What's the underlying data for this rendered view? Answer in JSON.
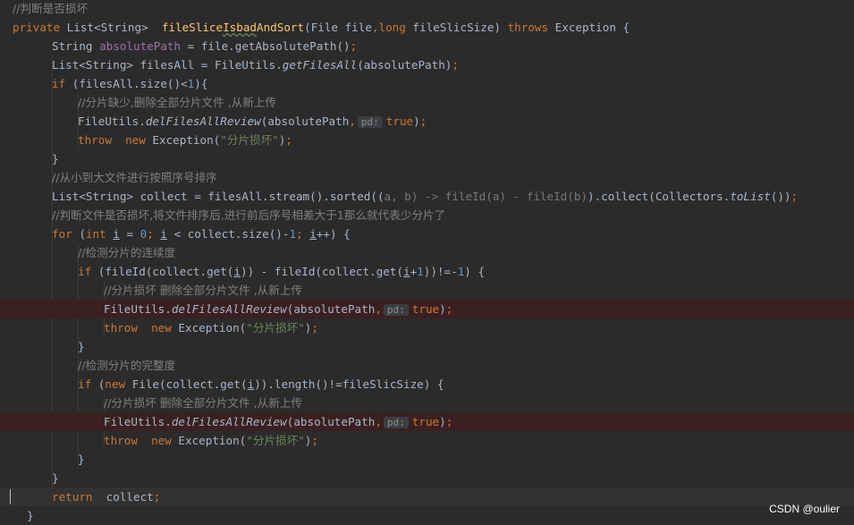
{
  "editor": {
    "lines": [
      {
        "tokens": [
          {
            "t": "//判断是否损坏",
            "c": "cm"
          }
        ]
      },
      {
        "tokens": [
          {
            "t": "private ",
            "c": "kw"
          },
          {
            "t": "List<String>  ",
            "c": "pl"
          },
          {
            "t": "fileSlice",
            "c": "fn"
          },
          {
            "t": "Isbad",
            "c": "fn wavy"
          },
          {
            "t": "AndSort",
            "c": "fn"
          },
          {
            "t": "(File file",
            "c": "pl"
          },
          {
            "t": ",",
            "c": "kw"
          },
          {
            "t": "long ",
            "c": "kw"
          },
          {
            "t": "fileSlicSize) ",
            "c": "pl"
          },
          {
            "t": "throws ",
            "c": "kw"
          },
          {
            "t": "Exception {",
            "c": "pl"
          }
        ]
      },
      {
        "tokens": [
          {
            "t": "String ",
            "c": "pl"
          },
          {
            "t": "absolutePath",
            "c": "var"
          },
          {
            "t": " = file.getAbsolutePath()",
            "c": "pl"
          },
          {
            "t": ";",
            "c": "kw"
          }
        ]
      },
      {
        "tokens": [
          {
            "t": "List<String> filesAll = FileUtils.",
            "c": "pl"
          },
          {
            "t": "getFilesAll",
            "c": "pl it"
          },
          {
            "t": "(absolutePath)",
            "c": "pl"
          },
          {
            "t": ";",
            "c": "kw"
          }
        ]
      },
      {
        "tokens": [
          {
            "t": "if ",
            "c": "kw"
          },
          {
            "t": "(filesAll.size()<",
            "c": "pl"
          },
          {
            "t": "1",
            "c": "num"
          },
          {
            "t": "){",
            "c": "pl"
          }
        ]
      },
      {
        "tokens": [
          {
            "t": "//分片缺少,删除全部分片文件 ,从新上传",
            "c": "cm"
          }
        ]
      },
      {
        "tokens": [
          {
            "t": "FileUtils.",
            "c": "pl"
          },
          {
            "t": "delFilesAllReview",
            "c": "pl it"
          },
          {
            "t": "(absolutePath",
            "c": "pl"
          },
          {
            "t": ",",
            "c": "kw"
          },
          {
            "t": "pd:",
            "c": "hint"
          },
          {
            "t": "true",
            "c": "kw"
          },
          {
            "t": ")",
            "c": "pl"
          },
          {
            "t": ";",
            "c": "kw"
          }
        ]
      },
      {
        "tokens": [
          {
            "t": "throw  ",
            "c": "kw"
          },
          {
            "t": "new ",
            "c": "kw"
          },
          {
            "t": "Exception(",
            "c": "pl"
          },
          {
            "t": "\"分片损坏\"",
            "c": "str"
          },
          {
            "t": ")",
            "c": "pl"
          },
          {
            "t": ";",
            "c": "kw"
          }
        ]
      },
      {
        "tokens": [
          {
            "t": "}",
            "c": "pl"
          }
        ]
      },
      {
        "tokens": [
          {
            "t": "//从小到大文件进行按照序号排序",
            "c": "cm"
          }
        ]
      },
      {
        "tokens": [
          {
            "t": "List<String> collect = filesAll.stream().sorted((",
            "c": "pl"
          },
          {
            "t": "a, b) -> fileId(a) - fileId(b)",
            "c": "dim"
          },
          {
            "t": ").collect(Collectors.",
            "c": "pl"
          },
          {
            "t": "toList",
            "c": "pl it"
          },
          {
            "t": "())",
            "c": "pl"
          },
          {
            "t": ";",
            "c": "kw"
          }
        ]
      },
      {
        "tokens": [
          {
            "t": "//判断文件是否损坏,将文件排序后,进行前后序号相差大于1那么就代表少分片了",
            "c": "cm"
          }
        ]
      },
      {
        "tokens": [
          {
            "t": "for ",
            "c": "kw"
          },
          {
            "t": "(",
            "c": "pl"
          },
          {
            "t": "int ",
            "c": "kw"
          },
          {
            "t": "i",
            "c": "pl ul"
          },
          {
            "t": " = ",
            "c": "pl"
          },
          {
            "t": "0",
            "c": "num"
          },
          {
            "t": "; ",
            "c": "kw"
          },
          {
            "t": "i",
            "c": "pl ul"
          },
          {
            "t": " < collect.size()-",
            "c": "pl"
          },
          {
            "t": "1",
            "c": "num"
          },
          {
            "t": "; ",
            "c": "kw"
          },
          {
            "t": "i",
            "c": "pl ul"
          },
          {
            "t": "++) {",
            "c": "pl"
          }
        ]
      },
      {
        "tokens": [
          {
            "t": "//检测分片的连续度",
            "c": "cm"
          }
        ]
      },
      {
        "tokens": [
          {
            "t": "if ",
            "c": "kw"
          },
          {
            "t": "(fileId(collect.get(",
            "c": "pl"
          },
          {
            "t": "i",
            "c": "pl ul"
          },
          {
            "t": ")) - fileId(collect.get(",
            "c": "pl"
          },
          {
            "t": "i",
            "c": "pl ul"
          },
          {
            "t": "+",
            "c": "pl"
          },
          {
            "t": "1",
            "c": "num"
          },
          {
            "t": "))!=-",
            "c": "pl"
          },
          {
            "t": "1",
            "c": "num"
          },
          {
            "t": ") {",
            "c": "pl"
          }
        ]
      },
      {
        "tokens": [
          {
            "t": "//分片损坏 删除全部分片文件 ,从新上传",
            "c": "cm"
          }
        ]
      },
      {
        "tokens": [
          {
            "t": "FileUtils.",
            "c": "pl"
          },
          {
            "t": "delFilesAllReview",
            "c": "pl it"
          },
          {
            "t": "(absolutePath",
            "c": "pl"
          },
          {
            "t": ",",
            "c": "kw"
          },
          {
            "t": "pd:",
            "c": "hint"
          },
          {
            "t": "true",
            "c": "kw"
          },
          {
            "t": ")",
            "c": "pl"
          },
          {
            "t": ";",
            "c": "kw"
          }
        ]
      },
      {
        "tokens": [
          {
            "t": "throw  ",
            "c": "kw"
          },
          {
            "t": "new ",
            "c": "kw"
          },
          {
            "t": "Exception(",
            "c": "pl"
          },
          {
            "t": "\"分片损坏\"",
            "c": "str"
          },
          {
            "t": ")",
            "c": "pl"
          },
          {
            "t": ";",
            "c": "kw"
          }
        ]
      },
      {
        "tokens": [
          {
            "t": "}",
            "c": "pl"
          }
        ]
      },
      {
        "tokens": [
          {
            "t": "//检测分片的完整度",
            "c": "cm"
          }
        ]
      },
      {
        "tokens": [
          {
            "t": "if ",
            "c": "kw"
          },
          {
            "t": "(",
            "c": "pl"
          },
          {
            "t": "new ",
            "c": "kw"
          },
          {
            "t": "File(collect.get(",
            "c": "pl"
          },
          {
            "t": "i",
            "c": "pl ul"
          },
          {
            "t": ")).length()!=fileSlicSize) {",
            "c": "pl"
          }
        ]
      },
      {
        "tokens": [
          {
            "t": "//分片损坏 删除全部分片文件 ,从新上传",
            "c": "cm"
          }
        ]
      },
      {
        "tokens": [
          {
            "t": "FileUtils.",
            "c": "pl"
          },
          {
            "t": "delFilesAllReview",
            "c": "pl it"
          },
          {
            "t": "(absolutePath",
            "c": "pl"
          },
          {
            "t": ",",
            "c": "kw"
          },
          {
            "t": "pd:",
            "c": "hint"
          },
          {
            "t": "true",
            "c": "kw"
          },
          {
            "t": ")",
            "c": "pl"
          },
          {
            "t": ";",
            "c": "kw"
          }
        ]
      },
      {
        "tokens": [
          {
            "t": "throw  ",
            "c": "kw"
          },
          {
            "t": "new ",
            "c": "kw"
          },
          {
            "t": "Exception(",
            "c": "pl"
          },
          {
            "t": "\"分片损坏\"",
            "c": "str"
          },
          {
            "t": ")",
            "c": "pl"
          },
          {
            "t": ";",
            "c": "kw"
          }
        ]
      },
      {
        "tokens": [
          {
            "t": "}",
            "c": "pl"
          }
        ]
      },
      {
        "tokens": [
          {
            "t": "}",
            "c": "pl"
          }
        ]
      },
      {
        "tokens": [
          {
            "t": "return  ",
            "c": "kw"
          },
          {
            "t": "collect",
            "c": "pl"
          },
          {
            "t": ";",
            "c": "kw"
          }
        ]
      },
      {
        "tokens": [
          {
            "t": "}",
            "c": "pl"
          }
        ]
      }
    ]
  },
  "colors": {
    "background": "#2b2b2b",
    "keyword": "#cc7832",
    "method_declaration": "#ffc66d",
    "plain": "#a9b7c6",
    "string": "#6a8759",
    "number": "#6897bb",
    "comment": "#808080",
    "field": "#9876aa",
    "error_line": "#3a2020"
  },
  "watermark": "CSDN @oulier"
}
